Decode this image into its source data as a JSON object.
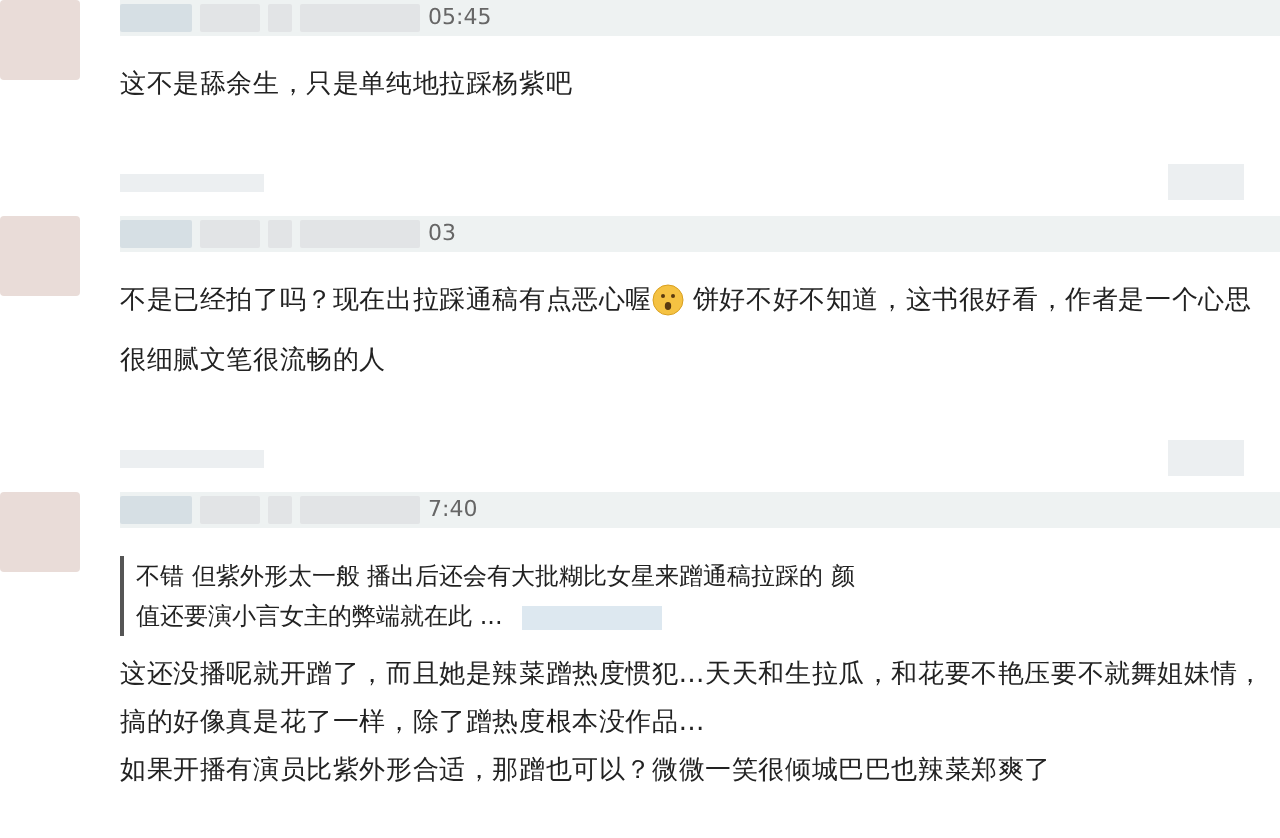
{
  "comments": [
    {
      "header_text": "05:45",
      "body": [
        {
          "kind": "text",
          "text": "这不是舔余生，只是单纯地拉踩杨紫吧"
        }
      ]
    },
    {
      "header_text": "03",
      "body": [
        {
          "kind": "text",
          "text": "不是已经拍了吗？现在出拉踩通稿有点恶心喔"
        },
        {
          "kind": "emoji"
        },
        {
          "kind": "text",
          "text": " 饼好不好不知道，这书很好看，作者是一个心思"
        },
        {
          "kind": "break"
        },
        {
          "kind": "text",
          "text": "很细腻文笔很流畅的人"
        }
      ]
    },
    {
      "header_text": "7:40",
      "quote_lines": [
        "不错 但紫外形太一般 播出后还会有大批糊比女星来蹭通稿拉踩的 颜",
        "值还要演小言女主的弊端就在此 ..."
      ],
      "body": [
        {
          "kind": "line",
          "text": "这还没播呢就开蹭了，而且她是辣菜蹭热度惯犯…天天和生拉瓜，和花要不艳压要不就舞姐妹情，"
        },
        {
          "kind": "line",
          "text": "搞的好像真是花了一样，除了蹭热度根本没作品…"
        },
        {
          "kind": "line",
          "text": "如果开播有演员比紫外形合适，那蹭也可以？微微一笑很倾城巴巴也辣菜郑爽了"
        }
      ]
    }
  ]
}
